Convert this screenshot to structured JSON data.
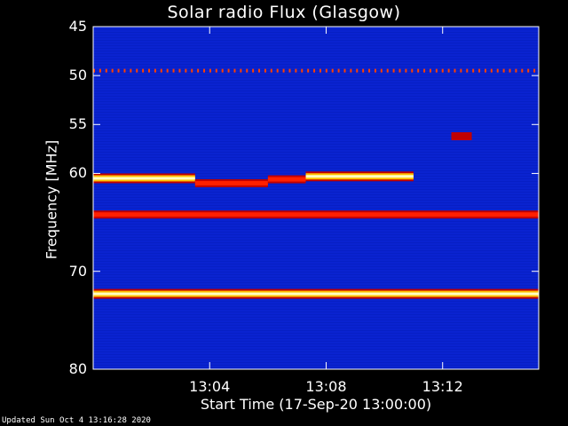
{
  "chart_data": {
    "type": "heatmap",
    "title": "Solar radio Flux (Glasgow)",
    "xlabel": "Start Time (17-Sep-20 13:00:00)",
    "ylabel": "Frequency [MHz]",
    "x_unit": "minutes after 13:00:00",
    "xlim": [
      0,
      15.3
    ],
    "ylim": [
      45,
      80
    ],
    "y_reversed": true,
    "x_ticks": [
      {
        "value": 4,
        "label": "13:04"
      },
      {
        "value": 8,
        "label": "13:08"
      },
      {
        "value": 12,
        "label": "13:12"
      }
    ],
    "y_ticks": [
      {
        "value": 45,
        "label": "45"
      },
      {
        "value": 50,
        "label": "50"
      },
      {
        "value": 55,
        "label": "55"
      },
      {
        "value": 60,
        "label": "60"
      },
      {
        "value": 70,
        "label": "70"
      },
      {
        "value": 80,
        "label": "80"
      }
    ],
    "colormap": [
      "#0000a0",
      "#0028f0",
      "#c00000",
      "#ff2000",
      "#ffc000",
      "#ffffc0"
    ],
    "background_color": "#0a23d0",
    "features": [
      {
        "name": "continuous band",
        "freq": 64.2,
        "t_start": 0,
        "t_end": 15.3,
        "intensity": "medium"
      },
      {
        "name": "continuous band",
        "freq": 72.3,
        "t_start": 0,
        "t_end": 15.3,
        "intensity": "high"
      },
      {
        "name": "periodic interference",
        "freq": 49.5,
        "t_start": 0,
        "t_end": 15.3,
        "intensity": "low"
      },
      {
        "name": "emission band",
        "freq": 60.5,
        "t_start": 0,
        "t_end": 3.5,
        "intensity": "high"
      },
      {
        "name": "emission band",
        "freq": 61.0,
        "t_start": 3.5,
        "t_end": 6.0,
        "intensity": "medium"
      },
      {
        "name": "emission band",
        "freq": 60.6,
        "t_start": 6.0,
        "t_end": 7.3,
        "intensity": "medium"
      },
      {
        "name": "emission band",
        "freq": 60.3,
        "t_start": 7.3,
        "t_end": 11.0,
        "intensity": "high"
      },
      {
        "name": "burst patch",
        "freq": 56.2,
        "t_start": 12.3,
        "t_end": 13.0,
        "intensity": "low"
      }
    ]
  },
  "footer": "Updated Sun Oct  4 13:16:28 2020"
}
